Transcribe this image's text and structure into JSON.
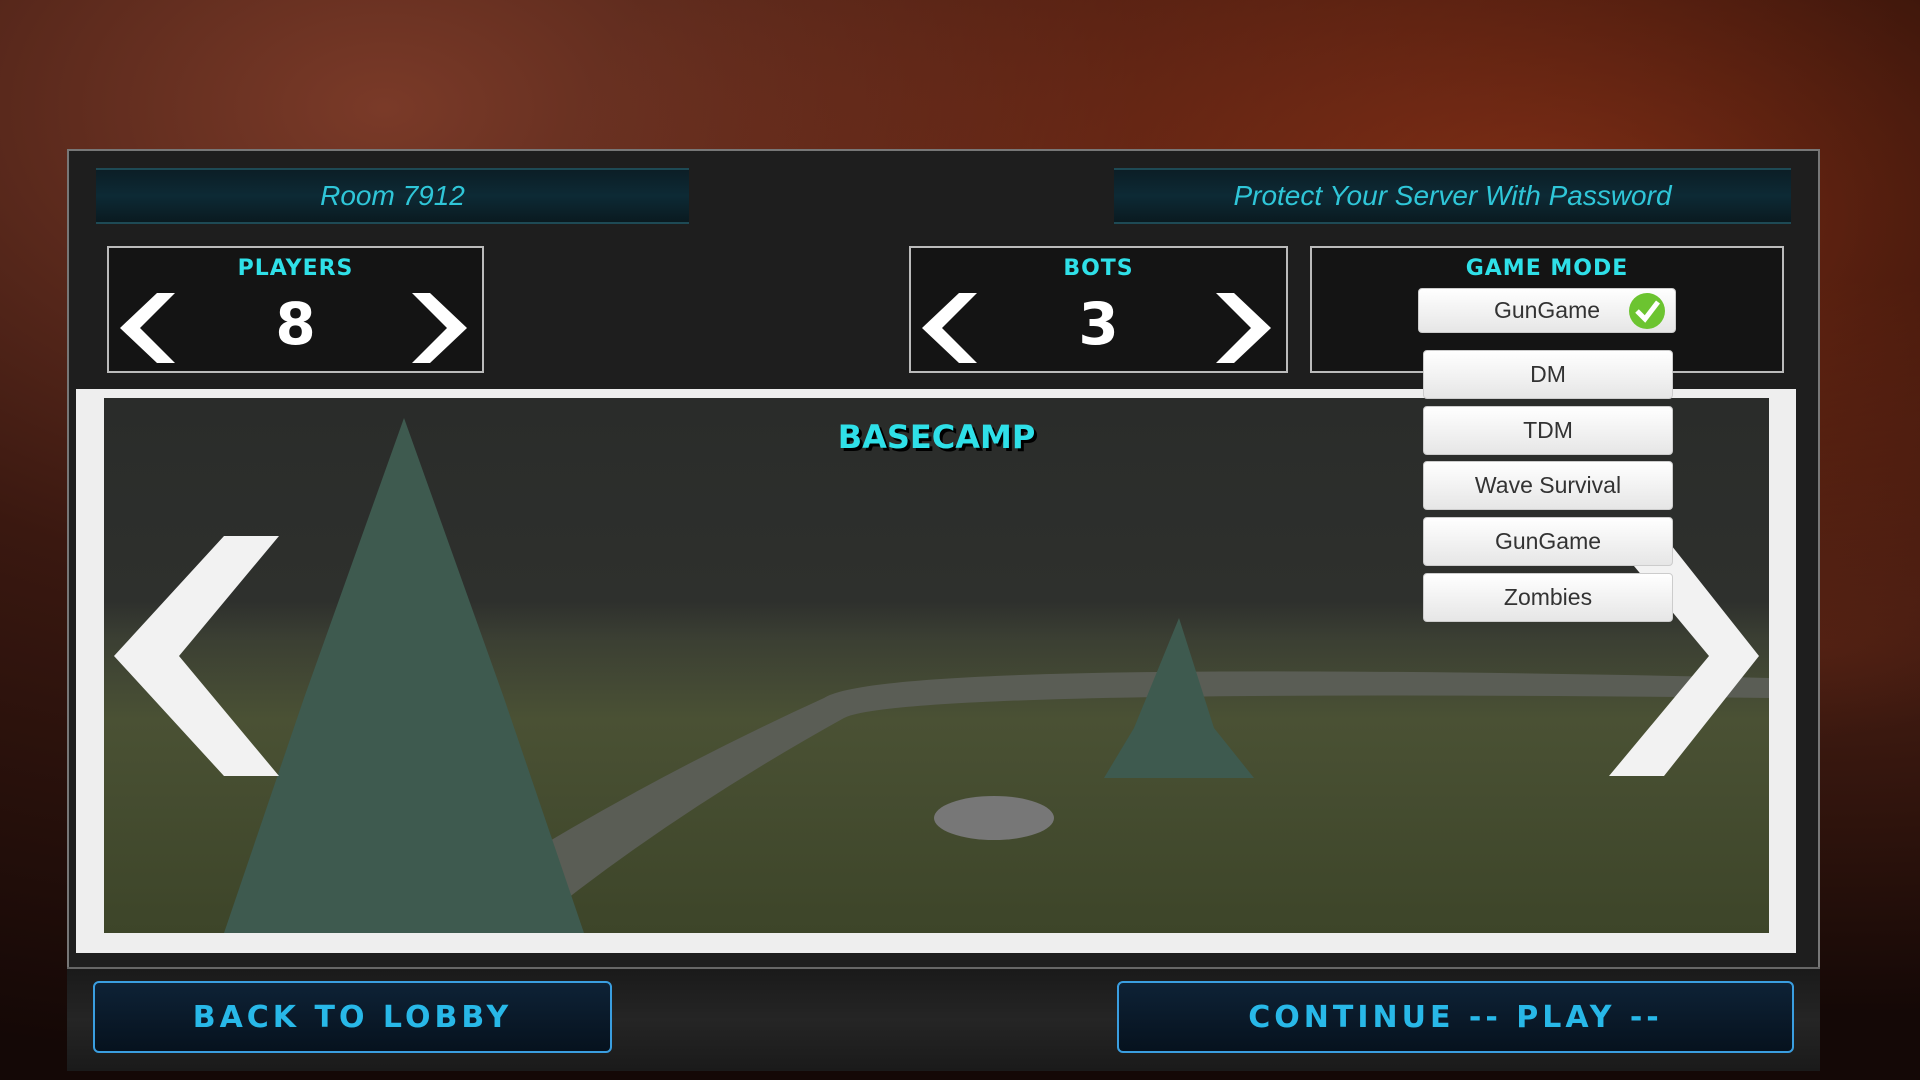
{
  "room": {
    "name": "Room 7912",
    "password_placeholder": "Protect Your Server With Password"
  },
  "players": {
    "label": "PLAYERS",
    "value": "8"
  },
  "bots": {
    "label": "BOTS",
    "value": "3"
  },
  "game_mode": {
    "label": "GAME MODE",
    "selected": "GunGame",
    "options": [
      "DM",
      "TDM",
      "Wave Survival",
      "GunGame",
      "Zombies"
    ]
  },
  "map": {
    "name": "BASECAMP"
  },
  "buttons": {
    "back": "BACK TO LOBBY",
    "continue": "CONTINUE -- PLAY --"
  },
  "colors": {
    "accent": "#2fe0e8",
    "button_text": "#28b8e8",
    "check": "#6cc430"
  }
}
